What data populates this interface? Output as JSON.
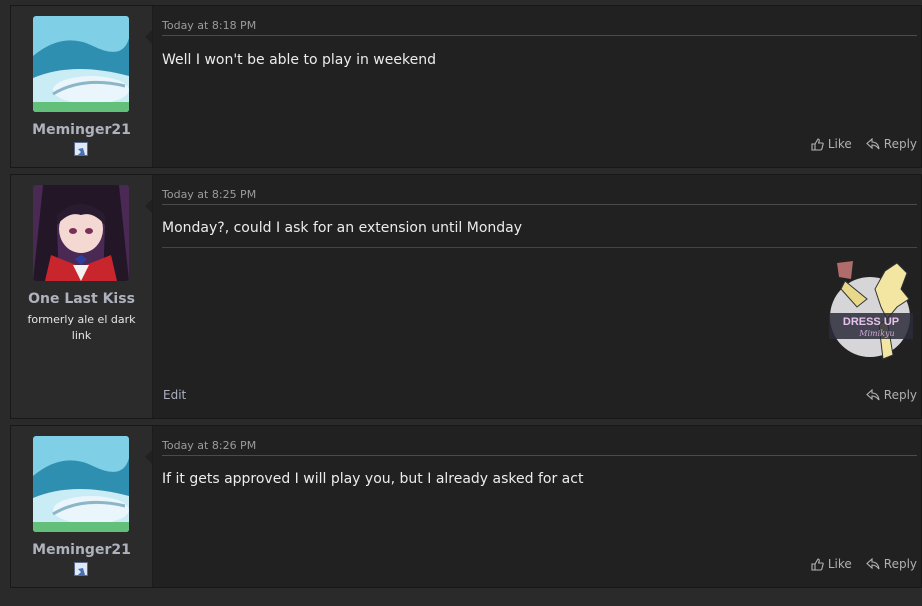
{
  "posts": [
    {
      "username": "Meminger21",
      "timestamp": "Today at 8:18 PM",
      "message": "Well I won't be able to play in weekend",
      "actions": {
        "like": "Like",
        "reply": "Reply"
      }
    },
    {
      "username": "One Last Kiss",
      "user_title": "formerly ale el dark link",
      "timestamp": "Today at 8:25 PM",
      "message": "Monday?, could I ask for an extension until Monday",
      "signature_text": [
        "DRESS UP",
        "Mimikyu"
      ],
      "actions": {
        "edit": "Edit",
        "reply": "Reply"
      }
    },
    {
      "username": "Meminger21",
      "timestamp": "Today at 8:26 PM",
      "message": "If it gets approved I will play you, but I already asked for act",
      "actions": {
        "like": "Like",
        "reply": "Reply"
      }
    }
  ],
  "icons": [
    "thumbs-up-icon",
    "reply-arrow-icon",
    "user-badge-icon"
  ],
  "colors": {
    "page_bg": "#2a2a2a",
    "post_bg": "#212121",
    "sidebar_bg": "#2b2b2b",
    "username": "#aeb2bd"
  }
}
